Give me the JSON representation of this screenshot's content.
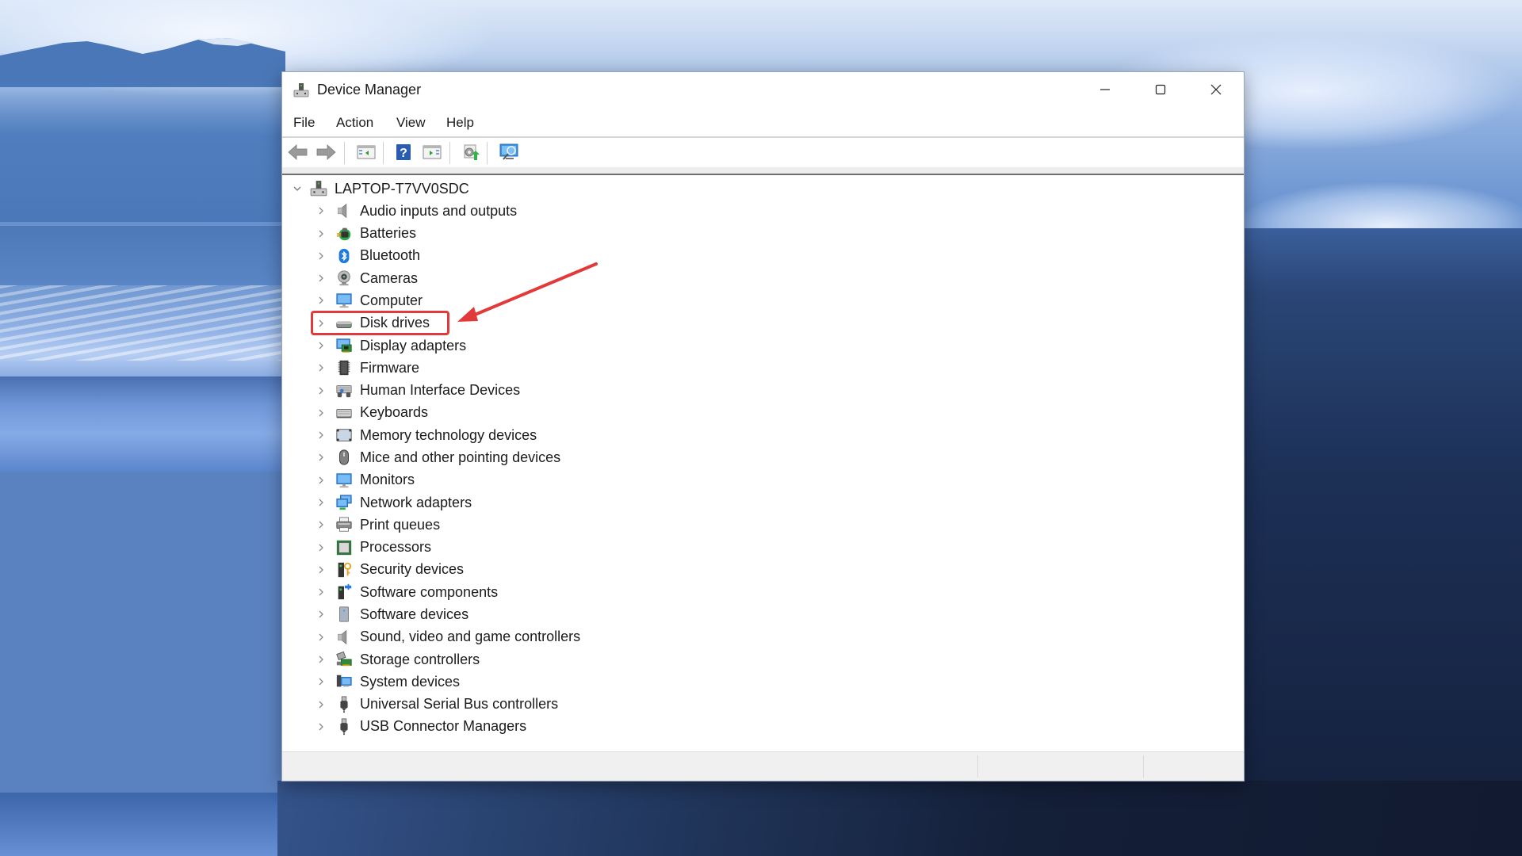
{
  "window": {
    "title": "Device Manager",
    "controls": {
      "minimize": "Minimize",
      "maximize": "Maximize",
      "close": "Close"
    }
  },
  "menu": {
    "items": [
      {
        "label": "File"
      },
      {
        "label": "Action"
      },
      {
        "label": "View"
      },
      {
        "label": "Help"
      }
    ]
  },
  "toolbar": {
    "buttons": [
      {
        "icon": "back-arrow-icon",
        "tooltip": "Back"
      },
      {
        "icon": "forward-arrow-icon",
        "tooltip": "Forward"
      },
      {
        "icon": "show-hide-console-tree-icon",
        "tooltip": "Show/Hide Console Tree"
      },
      {
        "icon": "help-icon",
        "tooltip": "Help"
      },
      {
        "icon": "show-hide-action-pane-icon",
        "tooltip": "Show/Hide Action Pane"
      },
      {
        "icon": "update-driver-icon",
        "tooltip": "Update Driver Software"
      },
      {
        "icon": "scan-hardware-icon",
        "tooltip": "Scan for hardware changes"
      }
    ]
  },
  "tree": {
    "root": {
      "label": "LAPTOP-T7VV0SDC",
      "expanded": true,
      "icon": "computer-node-icon"
    },
    "categories": [
      {
        "label": "Audio inputs and outputs",
        "icon": "speaker-icon"
      },
      {
        "label": "Batteries",
        "icon": "battery-icon"
      },
      {
        "label": "Bluetooth",
        "icon": "bluetooth-icon"
      },
      {
        "label": "Cameras",
        "icon": "webcam-icon"
      },
      {
        "label": "Computer",
        "icon": "monitor-icon"
      },
      {
        "label": "Disk drives",
        "icon": "disk-drive-icon",
        "highlighted": true
      },
      {
        "label": "Display adapters",
        "icon": "display-adapter-icon"
      },
      {
        "label": "Firmware",
        "icon": "chip-icon"
      },
      {
        "label": "Human Interface Devices",
        "icon": "hid-icon"
      },
      {
        "label": "Keyboards",
        "icon": "keyboard-icon"
      },
      {
        "label": "Memory technology devices",
        "icon": "memory-card-icon"
      },
      {
        "label": "Mice and other pointing devices",
        "icon": "mouse-icon"
      },
      {
        "label": "Monitors",
        "icon": "monitor-icon"
      },
      {
        "label": "Network adapters",
        "icon": "network-icon"
      },
      {
        "label": "Print queues",
        "icon": "printer-icon"
      },
      {
        "label": "Processors",
        "icon": "processor-icon"
      },
      {
        "label": "Security devices",
        "icon": "security-key-icon"
      },
      {
        "label": "Software components",
        "icon": "software-component-icon"
      },
      {
        "label": "Software devices",
        "icon": "software-device-icon"
      },
      {
        "label": "Sound, video and game controllers",
        "icon": "speaker-icon"
      },
      {
        "label": "Storage controllers",
        "icon": "storage-controller-icon"
      },
      {
        "label": "System devices",
        "icon": "system-devices-icon"
      },
      {
        "label": "Universal Serial Bus controllers",
        "icon": "usb-plug-icon"
      },
      {
        "label": "USB Connector Managers",
        "icon": "usb-plug-icon"
      }
    ]
  },
  "annotation": {
    "target": "Disk drives",
    "color": "#e23a3a"
  }
}
